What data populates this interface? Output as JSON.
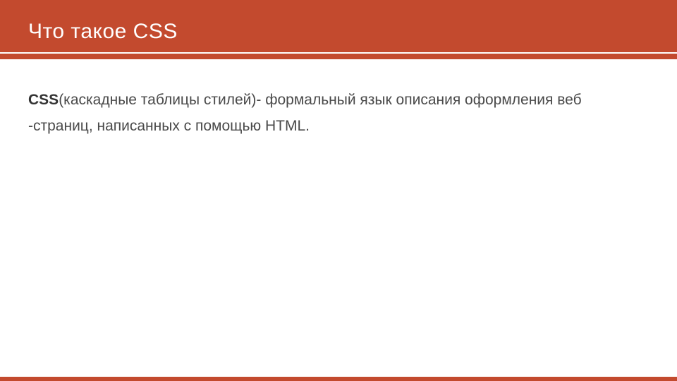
{
  "header": {
    "title": "Что такое CSS"
  },
  "body": {
    "bold_prefix": "CSS",
    "text_after_bold": "(каскадные таблицы стилей)- формальный язык описания оформления веб -страниц, написанных с помощью HTML."
  }
}
